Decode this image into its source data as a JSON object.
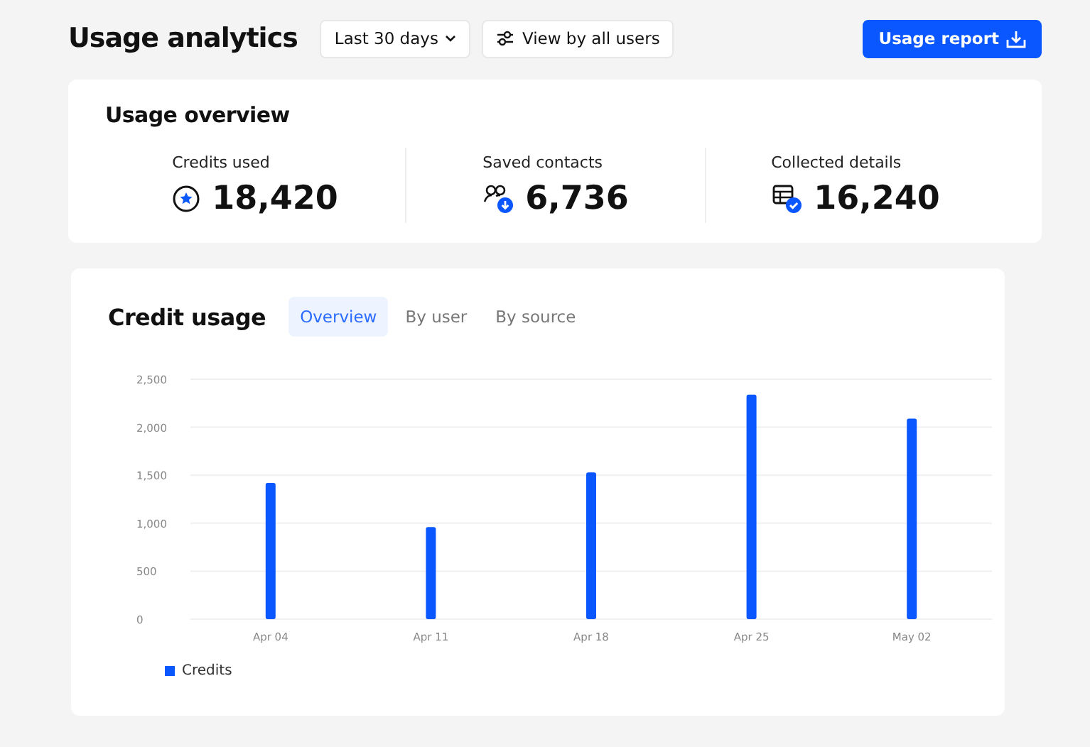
{
  "header": {
    "title": "Usage analytics",
    "period_button": "Last 30 days",
    "users_button": "View by all users",
    "report_button": "Usage report"
  },
  "overview": {
    "title": "Usage overview",
    "stats": [
      {
        "kind": "credits",
        "label": "Credits used",
        "value": "18,420"
      },
      {
        "kind": "contacts",
        "label": "Saved contacts",
        "value": "6,736"
      },
      {
        "kind": "details",
        "label": "Collected details",
        "value": "16,240"
      }
    ]
  },
  "credit_usage": {
    "title": "Credit usage",
    "tabs": [
      {
        "label": "Overview",
        "selected": true
      },
      {
        "label": "By user",
        "selected": false
      },
      {
        "label": "By source",
        "selected": false
      }
    ],
    "chart_data": {
      "type": "bar",
      "categories": [
        "Apr 04",
        "Apr 11",
        "Apr 18",
        "Apr 25",
        "May 02"
      ],
      "series": [
        {
          "name": "Credits",
          "color": "#0b57ff",
          "values": [
            1420,
            960,
            1530,
            2340,
            2090
          ]
        }
      ],
      "ylim": [
        0,
        2500
      ],
      "grid": true,
      "yticks": [
        {
          "value": 0,
          "label": "0"
        },
        {
          "value": 500,
          "label": "500"
        },
        {
          "value": 1000,
          "label": "1,000"
        },
        {
          "value": 1500,
          "label": "1,500"
        },
        {
          "value": 2000,
          "label": "2,000"
        },
        {
          "value": 2500,
          "label": "2,500"
        }
      ]
    }
  }
}
